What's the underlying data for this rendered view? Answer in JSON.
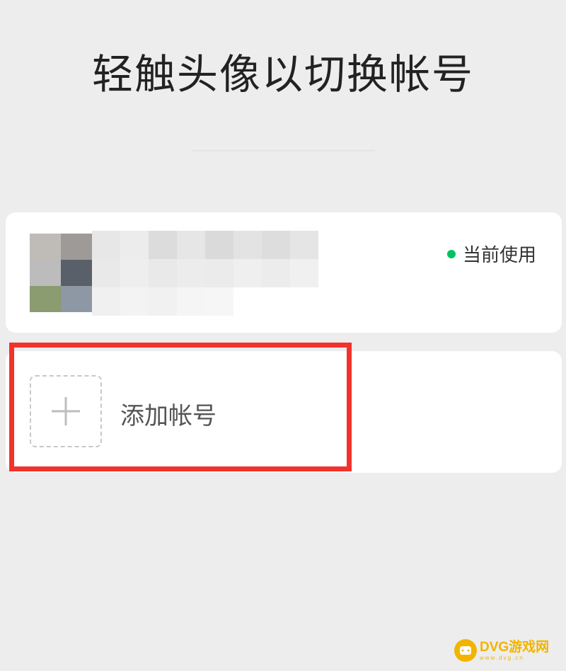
{
  "header": {
    "title": "轻触头像以切换帐号"
  },
  "current_account": {
    "status_label": "当前使用",
    "status_color": "#07c160",
    "avatar_icon": "avatar-pixelated",
    "name_icon": "blurred-name"
  },
  "add_account": {
    "label": "添加帐号",
    "icon": "plus-icon"
  },
  "highlight": {
    "color": "#f2322d"
  },
  "watermark": {
    "main": "DVG游戏网",
    "sub": "www.dvg.cn"
  }
}
